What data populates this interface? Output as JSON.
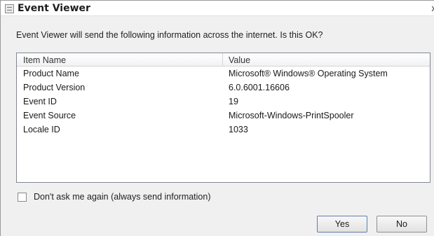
{
  "window": {
    "title": "Event Viewer",
    "close_glyph": "x",
    "icon": "event-viewer-icon"
  },
  "prompt": "Event Viewer will send the following information across the internet. Is this OK?",
  "table": {
    "columns": [
      "Item Name",
      "Value"
    ],
    "rows": [
      {
        "item": "Product Name",
        "value": "Microsoft® Windows® Operating System"
      },
      {
        "item": "Product Version",
        "value": "6.0.6001.16606"
      },
      {
        "item": "Event ID",
        "value": "19"
      },
      {
        "item": "Event Source",
        "value": "Microsoft-Windows-PrintSpooler"
      },
      {
        "item": "Locale ID",
        "value": "1033"
      }
    ]
  },
  "checkbox": {
    "label": "Don't ask me again (always send information)",
    "checked": false
  },
  "buttons": {
    "yes": "Yes",
    "no": "No"
  }
}
